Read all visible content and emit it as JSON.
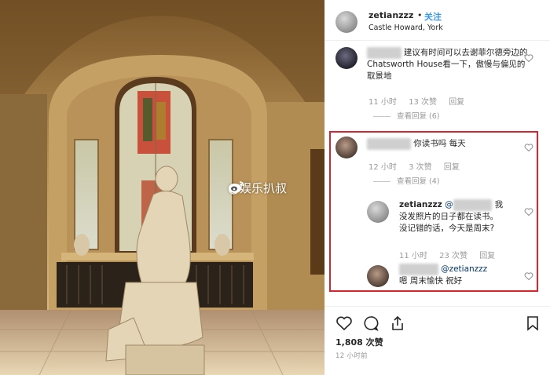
{
  "post": {
    "username": "zetianzzz",
    "separator": "•",
    "follow_label": "关注",
    "location": "Castle Howard, York"
  },
  "watermark": {
    "text": "@娱乐扒叔",
    "icon": "weibo-icon"
  },
  "comments": [
    {
      "text": "建议有时间可以去谢菲尔德旁边的Chatsworth House看一下，傲慢与偏见的取景地",
      "time": "11 小时",
      "likes": "13 次赞",
      "reply_label": "回复",
      "view_replies": "查看回复 (6)"
    },
    {
      "text": "你读书吗 每天",
      "time": "12 小时",
      "likes": "3 次赞",
      "reply_label": "回复",
      "view_replies": "查看回复 (4)"
    },
    {
      "username": "zetianzzz",
      "mention": "@",
      "text_line1": "我",
      "text_line2": "没发照片的日子都在读书。",
      "text_line3": "没记错的话，今天是周末?",
      "time": "11 小时",
      "likes": "23 次赞",
      "reply_label": "回复"
    },
    {
      "mention": "@zetianzzz",
      "text": "嗯 周末愉快 祝好"
    }
  ],
  "actions": {
    "icons": [
      "heart-icon",
      "comment-icon",
      "share-icon",
      "bookmark-icon"
    ],
    "likes_count": "1,808 次赞",
    "timestamp": "12 小时前"
  },
  "colors": {
    "follow_blue": "#3897f0",
    "highlight_red": "#d8242f",
    "meta_gray": "#999999"
  }
}
